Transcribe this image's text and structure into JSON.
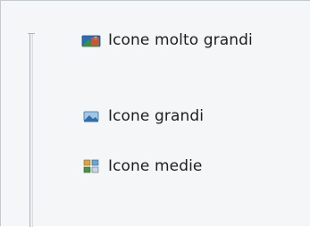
{
  "view_menu": {
    "items": [
      {
        "label": "Icone molto grandi",
        "icon": "extra-large-icons-icon"
      },
      {
        "label": "Icone grandi",
        "icon": "large-icons-icon"
      },
      {
        "label": "Icone medie",
        "icon": "medium-icons-icon"
      }
    ]
  },
  "colors": {
    "panel_background": "#f5f6f7",
    "text": "#1e1e1e",
    "slider_track": "#aeb5bd"
  }
}
